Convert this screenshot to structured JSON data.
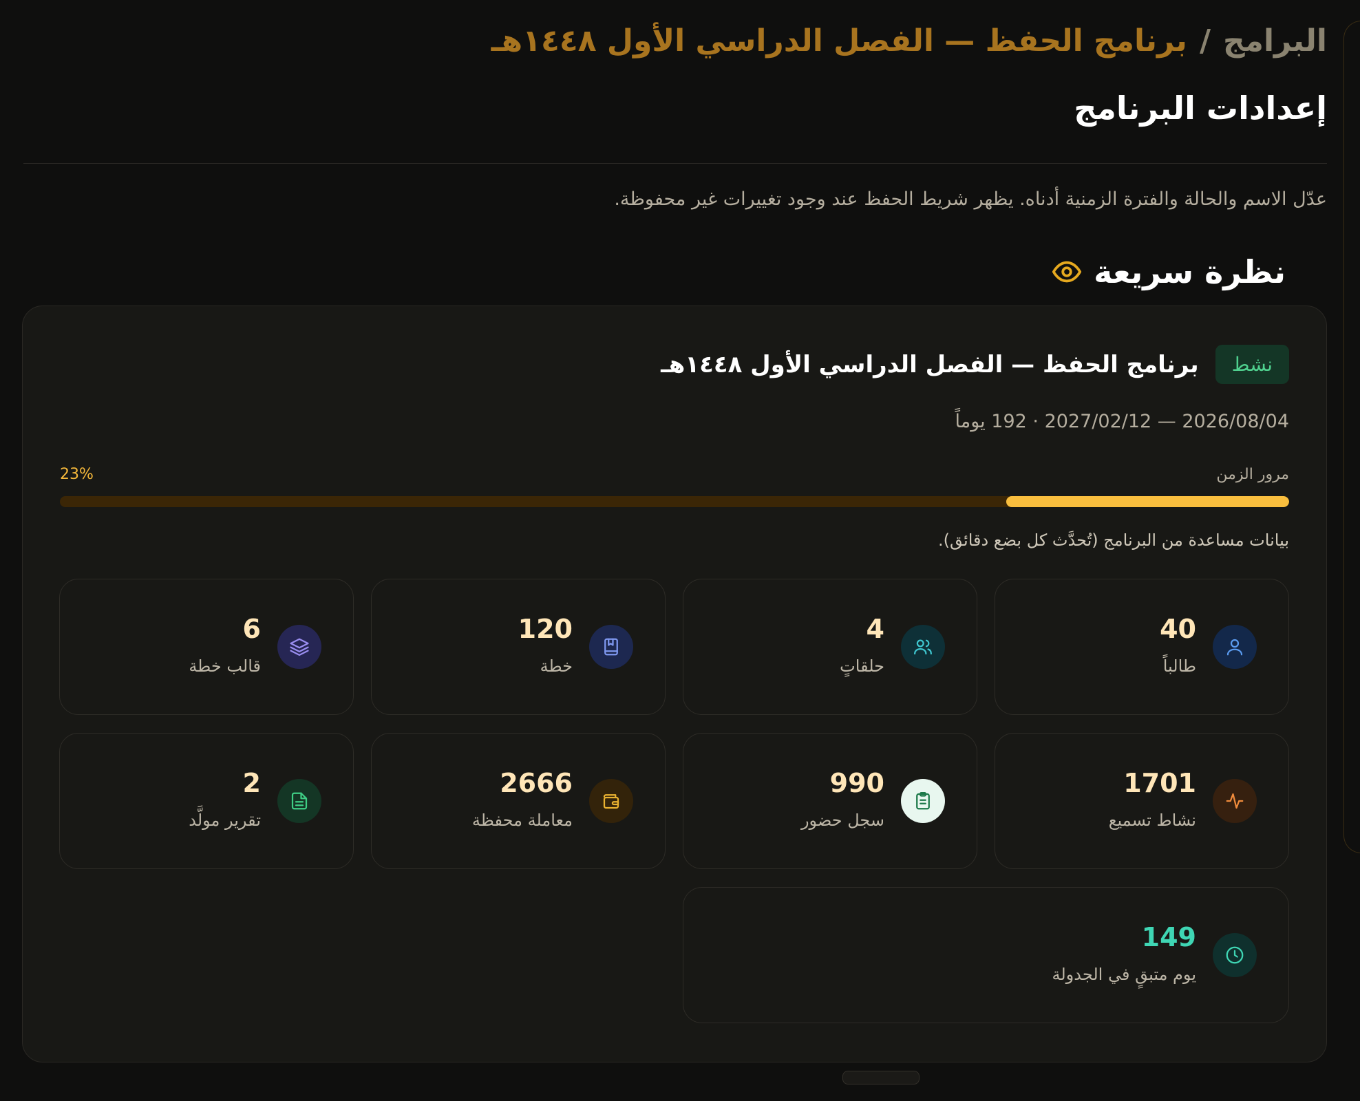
{
  "breadcrumb": {
    "root": "البرامج",
    "separator": "/",
    "current": "برنامج الحفظ — الفصل الدراسي الأول ١٤٤٨هـ"
  },
  "page_title": "إعدادات البرنامج",
  "page_description": "عدّل الاسم والحالة والفترة الزمنية أدناه. يظهر شريط الحفظ عند وجود تغييرات غير محفوظة.",
  "overview": {
    "title": "نظرة سريعة",
    "icon": "eye-icon",
    "status": "نشط",
    "program_name": "برنامج الحفظ — الفصل الدراسي الأول ١٤٤٨هـ",
    "date_range": "2026/08/04 — 2027/02/12 · 192 يوماً",
    "progress_label": "مرور الزمن",
    "progress_text": "23%",
    "progress_value": 0.23,
    "helper": "بيانات مساعدة من البرنامج (تُحدَّث كل بضع دقائق).",
    "stats": [
      {
        "value": "40",
        "label": "طالباً",
        "icon": "user-icon",
        "bg": "#13284a",
        "color": "#5b9cf0"
      },
      {
        "value": "4",
        "label": "حلقاتٍ",
        "icon": "users-icon",
        "bg": "#0e3037",
        "color": "#3fc6cf"
      },
      {
        "value": "120",
        "label": "خطة",
        "icon": "book-icon",
        "bg": "#1d2850",
        "color": "#7f98f0"
      },
      {
        "value": "6",
        "label": "قالب خطة",
        "icon": "layers-icon",
        "bg": "#262654",
        "color": "#9a8ef0"
      },
      {
        "value": "1701",
        "label": "نشاط تسميع",
        "icon": "activity-icon",
        "bg": "#36200f",
        "color": "#f08b3c"
      },
      {
        "value": "990",
        "label": "سجل حضور",
        "icon": "clipboard-icon",
        "bg": "#e8f7ef",
        "color": "#1d7a4a"
      },
      {
        "value": "2666",
        "label": "معاملة محفظة",
        "icon": "wallet-icon",
        "bg": "#33230a",
        "color": "#eab231"
      },
      {
        "value": "2",
        "label": "تقرير مولَّد",
        "icon": "file-icon",
        "bg": "#143625",
        "color": "#3fce85"
      },
      {
        "value": "149",
        "label": "يوم متبقٍ في الجدولة",
        "icon": "clock-icon",
        "bg": "#0f302d",
        "color": "#3fd6b4"
      }
    ]
  }
}
